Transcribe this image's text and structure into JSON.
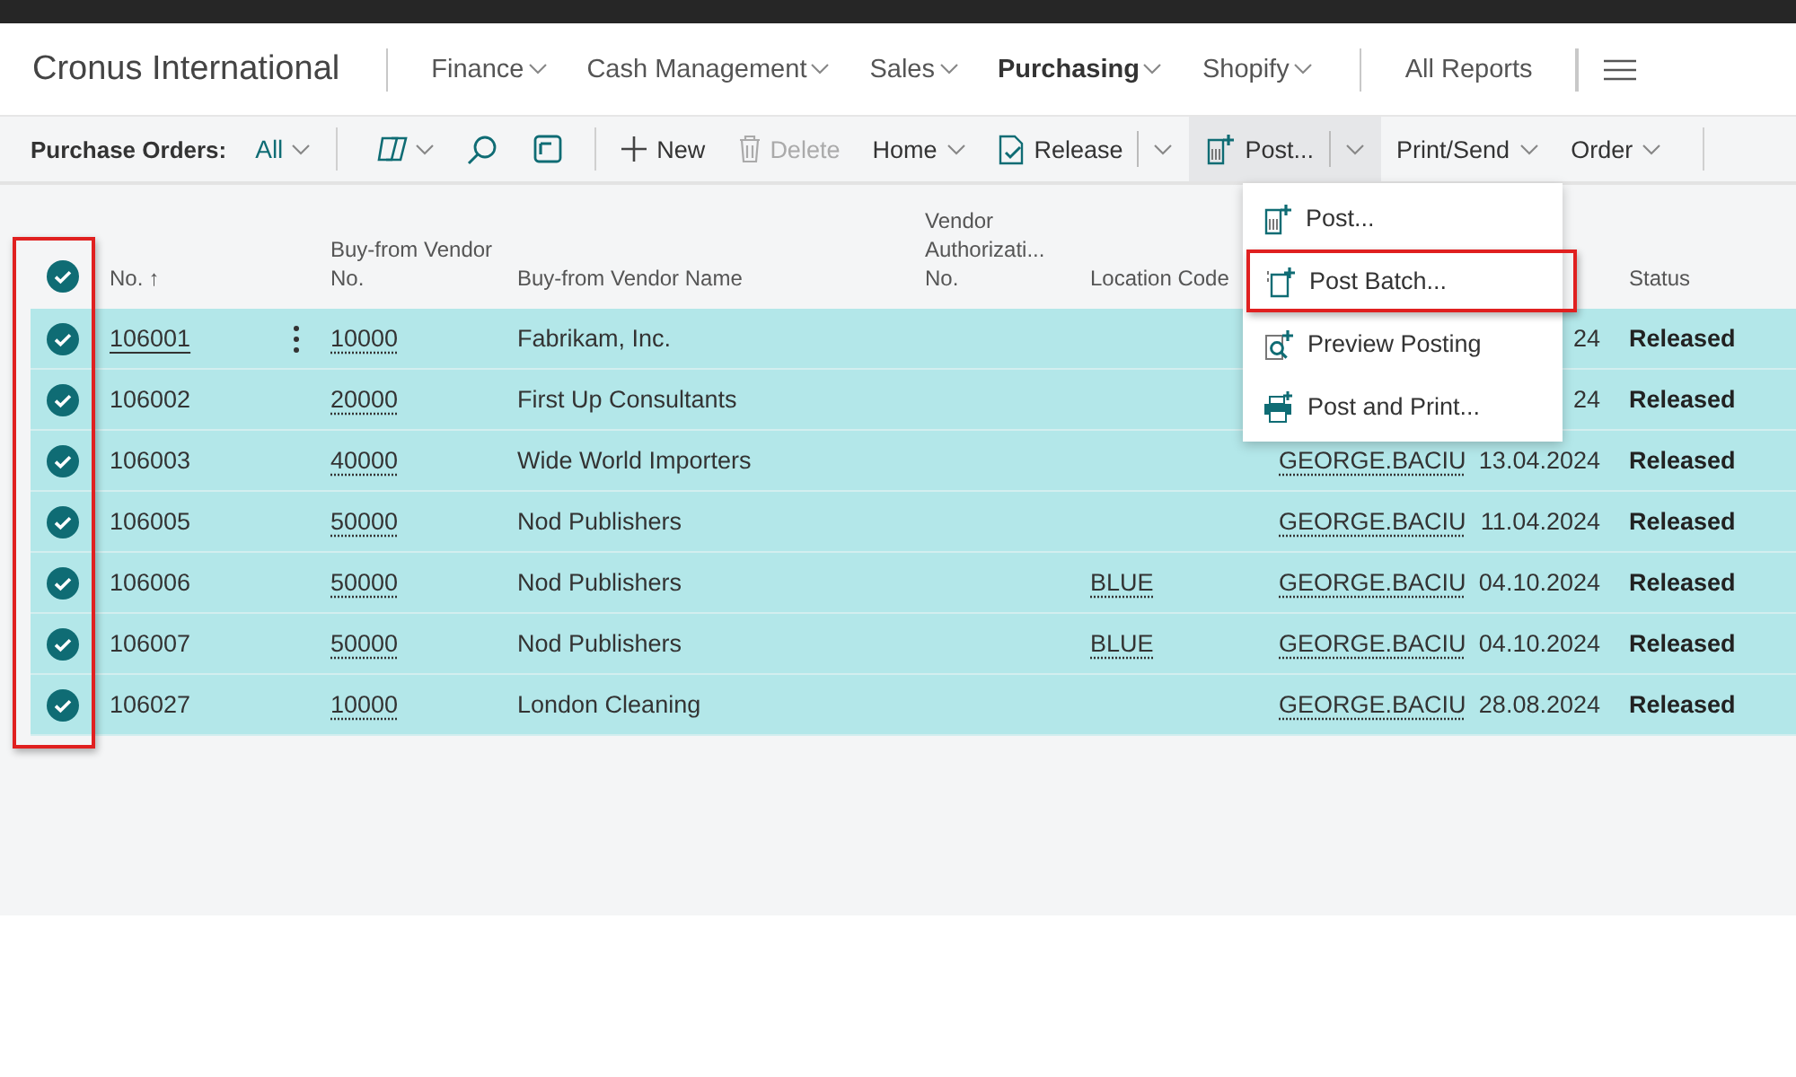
{
  "header": {
    "company": "Cronus International",
    "reports_link": "All Reports"
  },
  "nav": [
    {
      "label": "Finance",
      "selected": false
    },
    {
      "label": "Cash Management",
      "selected": false
    },
    {
      "label": "Sales",
      "selected": false
    },
    {
      "label": "Purchasing",
      "selected": true
    },
    {
      "label": "Shopify",
      "selected": false
    }
  ],
  "toolbar": {
    "page_title": "Purchase Orders:",
    "view": "All",
    "actions": [
      {
        "label": "New",
        "kind": "add",
        "disabled": false
      },
      {
        "label": "Delete",
        "kind": "delete",
        "disabled": true
      },
      {
        "label": "Home",
        "kind": "menu",
        "disabled": false
      },
      {
        "label": "Release",
        "kind": "split",
        "disabled": false,
        "expanded": false
      },
      {
        "label": "Post...",
        "kind": "split",
        "disabled": false,
        "expanded": true
      },
      {
        "label": "Print/Send",
        "kind": "menu",
        "disabled": false
      },
      {
        "label": "Order",
        "kind": "menu",
        "disabled": false
      }
    ]
  },
  "table": {
    "all_checked": true,
    "sort_indicator": "↑",
    "columns": [
      "No.",
      "Buy-from Vendor No.",
      "Buy-from Vendor Name",
      "Vendor Authorizati... No.",
      "Location Code",
      "Status"
    ],
    "rows": [
      {
        "checked": true,
        "focused": true,
        "no": "106001",
        "vendor_no": "10000",
        "vendor_name": "Fabrikam, Inc.",
        "date": "24",
        "status": "Released"
      },
      {
        "checked": true,
        "focused": false,
        "no": "106002",
        "vendor_no": "20000",
        "vendor_name": "First Up Consultants",
        "date": "24",
        "status": "Released"
      },
      {
        "checked": true,
        "focused": false,
        "no": "106003",
        "vendor_no": "40000",
        "vendor_name": "Wide World Importers",
        "user": "GEORGE.BACIU",
        "date": "13.04.2024",
        "status": "Released"
      },
      {
        "checked": true,
        "focused": false,
        "no": "106005",
        "vendor_no": "50000",
        "vendor_name": "Nod Publishers",
        "user": "GEORGE.BACIU",
        "date": "11.04.2024",
        "status": "Released"
      },
      {
        "checked": true,
        "focused": false,
        "no": "106006",
        "vendor_no": "50000",
        "vendor_name": "Nod Publishers",
        "location": "BLUE",
        "user": "GEORGE.BACIU",
        "date": "04.10.2024",
        "status": "Released"
      },
      {
        "checked": true,
        "focused": false,
        "no": "106007",
        "vendor_no": "50000",
        "vendor_name": "Nod Publishers",
        "location": "BLUE",
        "user": "GEORGE.BACIU",
        "date": "04.10.2024",
        "status": "Released"
      },
      {
        "checked": true,
        "focused": false,
        "no": "106027",
        "vendor_no": "10000",
        "vendor_name": "London Cleaning",
        "user": "GEORGE.BACIU",
        "date": "28.08.2024",
        "status": "Released"
      }
    ]
  },
  "post_menu": {
    "items": [
      {
        "label": "Post...",
        "highlighted": false
      },
      {
        "label": "Post Batch...",
        "highlighted": true
      },
      {
        "label": "Preview Posting",
        "highlighted": false
      },
      {
        "label": "Post and Print...",
        "highlighted": false
      }
    ]
  }
}
